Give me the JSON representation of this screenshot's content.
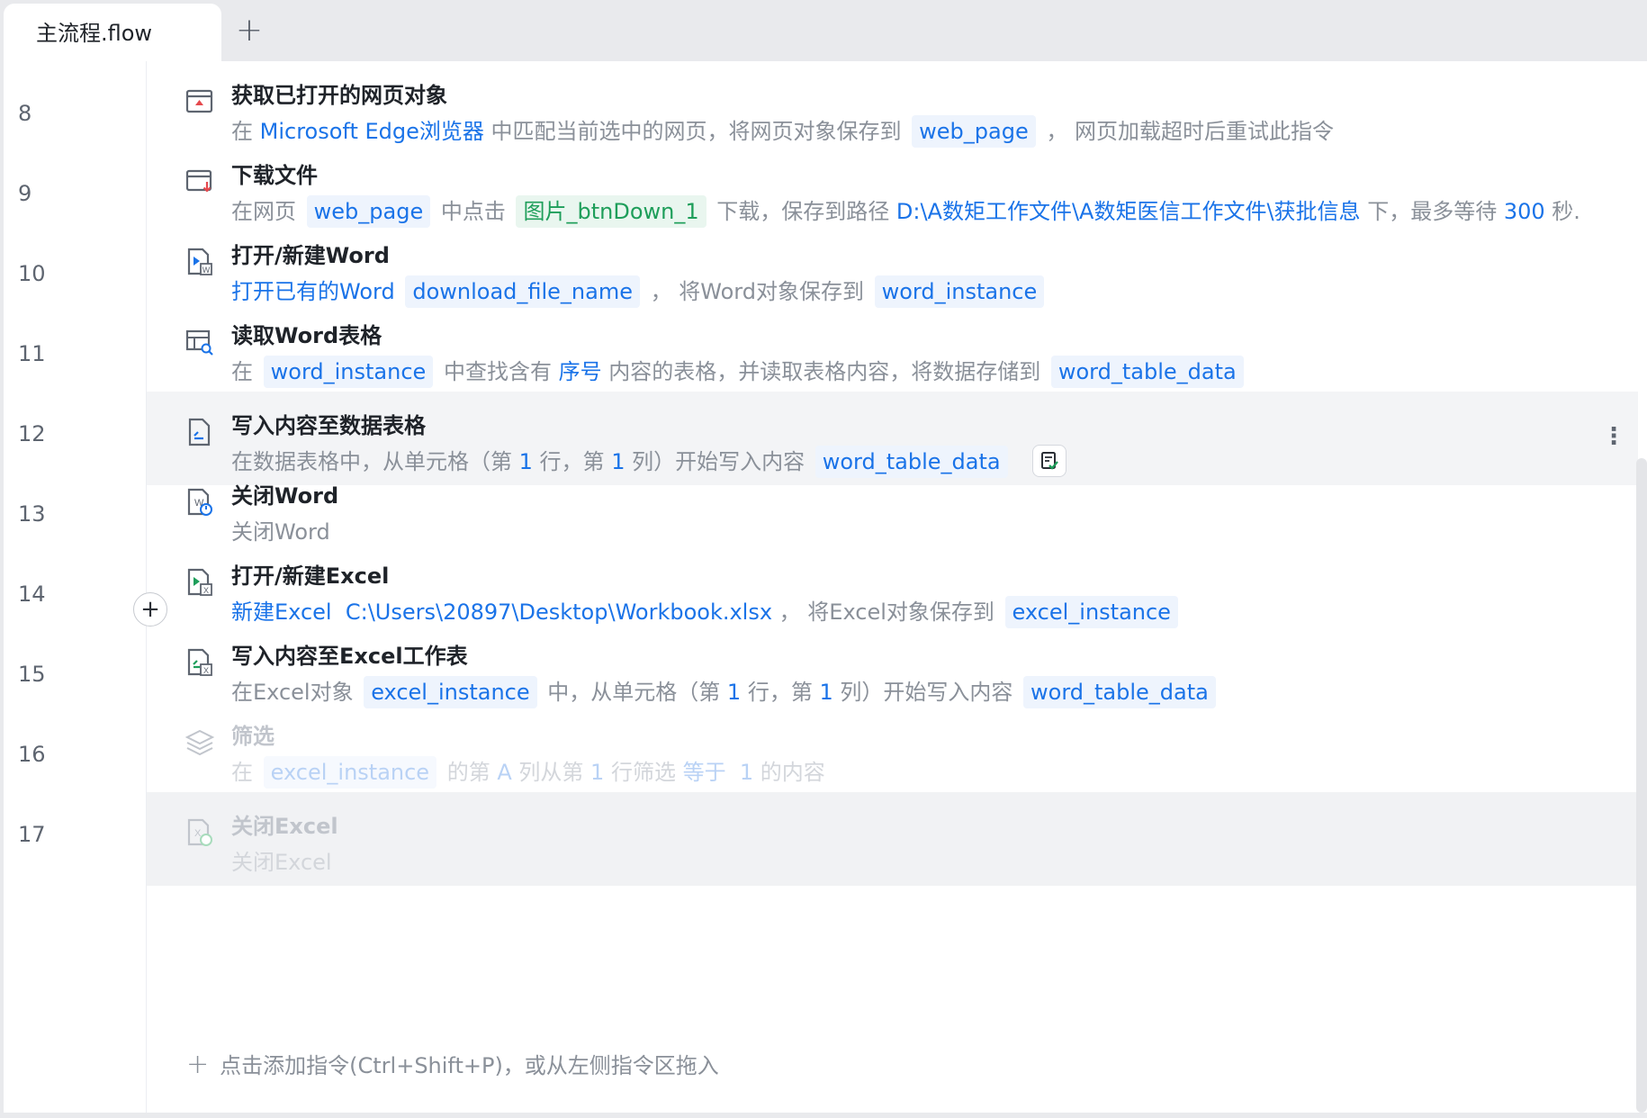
{
  "tabs": {
    "active": "主流程.flow",
    "add_symbol": "+"
  },
  "line_numbers": [
    "8",
    "9",
    "10",
    "11",
    "12",
    "13",
    "14",
    "15",
    "16",
    "17"
  ],
  "steps": [
    {
      "title": "获取已打开的网页对象",
      "icon": "browser-window-icon",
      "desc": {
        "t1": "在 ",
        "browser": "Microsoft Edge浏览器",
        "t2": " 中匹配当前选中的网页，将网页对象保存到 ",
        "var": "web_page",
        "t3": " ， 网页加载超时后重试此指令"
      }
    },
    {
      "title": "下载文件",
      "icon": "download-icon",
      "desc": {
        "t1": "在网页 ",
        "page": "web_page",
        "t2": " 中点击 ",
        "element": "图片_btnDown_1",
        "t3": " 下载，保存到路径 ",
        "path": "D:\\A数矩工作文件\\A数矩医信工作文件\\获批信息",
        "t4": " 下，最多等待 ",
        "seconds": "300",
        "t5": " 秒..."
      }
    },
    {
      "title": "打开/新建Word",
      "icon": "word-open-icon",
      "desc": {
        "mode": "打开已有的Word",
        "file": "download_file_name",
        "t1": " ， 将Word对象保存到 ",
        "var": "word_instance"
      }
    },
    {
      "title": "读取Word表格",
      "icon": "table-search-icon",
      "desc": {
        "t1": "在 ",
        "obj": "word_instance",
        "t2": " 中查找含有 ",
        "keyword": "序号",
        "t3": " 内容的表格，并读取表格内容，将数据存储到 ",
        "var": "word_table_data"
      }
    },
    {
      "title": "写入内容至数据表格",
      "icon": "sheet-write-icon",
      "desc": {
        "t1": "在数据表格中，从单元格（第 ",
        "row": "1",
        "t2": " 行，第 ",
        "col": "1",
        "t3": " 列）开始写入内容 ",
        "var": "word_table_data"
      }
    },
    {
      "title": "关闭Word",
      "icon": "word-close-icon",
      "desc": {
        "t1": "关闭Word"
      }
    },
    {
      "title": "打开/新建Excel",
      "icon": "excel-open-icon",
      "desc": {
        "mode": "新建Excel",
        "path": "C:\\Users\\20897\\Desktop\\Workbook.xlsx",
        "t1": " ， 将Excel对象保存到 ",
        "var": "excel_instance"
      }
    },
    {
      "title": "写入内容至Excel工作表",
      "icon": "excel-write-icon",
      "desc": {
        "t1": "在Excel对象 ",
        "obj": "excel_instance",
        "t2": " 中，从单元格（第 ",
        "row": "1",
        "t3": " 行，第 ",
        "col": "1",
        "t4": " 列）开始写入内容 ",
        "var": "word_table_data"
      }
    },
    {
      "title": "筛选",
      "icon": "layers-filter-icon",
      "desc": {
        "t1": "在 ",
        "obj": "excel_instance",
        "t2": " 的第 ",
        "col": "A",
        "t3": " 列从第 ",
        "row": "1",
        "t4": " 行筛选 ",
        "op": "等于",
        "value": "1",
        "t5": " 的内容"
      }
    },
    {
      "title": "关闭Excel",
      "icon": "excel-close-icon",
      "desc": {
        "t1": "关闭Excel"
      }
    }
  ],
  "add_hint": "点击添加指令(Ctrl+Shift+P)，或从左侧指令区拖入",
  "colors": {
    "link": "#1a73e8",
    "chip_bg": "#eef4fd",
    "green": "#1e9e5a"
  }
}
